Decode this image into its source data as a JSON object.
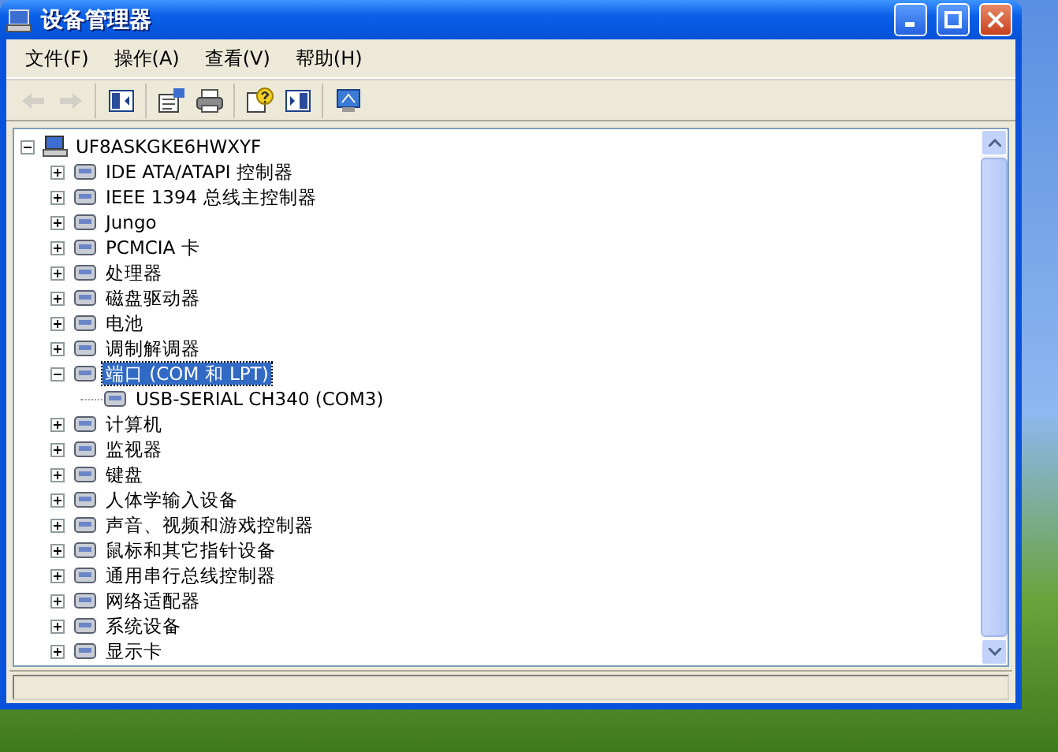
{
  "window": {
    "title": "设备管理器"
  },
  "menu": [
    {
      "label": "文件(F)"
    },
    {
      "label": "操作(A)"
    },
    {
      "label": "查看(V)"
    },
    {
      "label": "帮助(H)"
    }
  ],
  "toolbar": [
    [
      {
        "kind": "back",
        "disabled": true
      },
      {
        "kind": "forward",
        "disabled": true
      }
    ],
    [
      {
        "kind": "tree-toggle",
        "disabled": false
      }
    ],
    [
      {
        "kind": "properties",
        "disabled": false
      },
      {
        "kind": "print",
        "disabled": false
      }
    ],
    [
      {
        "kind": "help",
        "disabled": false
      },
      {
        "kind": "panel",
        "disabled": false
      }
    ],
    [
      {
        "kind": "scan",
        "disabled": false
      }
    ]
  ],
  "tree": [
    {
      "label": "UF8ASKGKE6HWXYF",
      "expanded": true,
      "selected": false,
      "children": [
        {
          "label": "IDE ATA/ATAPI 控制器",
          "expanded": false,
          "selected": false
        },
        {
          "label": "IEEE 1394 总线主控制器",
          "expanded": false,
          "selected": false
        },
        {
          "label": "Jungo",
          "expanded": false,
          "selected": false
        },
        {
          "label": "PCMCIA 卡",
          "expanded": false,
          "selected": false
        },
        {
          "label": "处理器",
          "expanded": false,
          "selected": false
        },
        {
          "label": "磁盘驱动器",
          "expanded": false,
          "selected": false
        },
        {
          "label": "电池",
          "expanded": false,
          "selected": false
        },
        {
          "label": "调制解调器",
          "expanded": false,
          "selected": false
        },
        {
          "label": "端口 (COM 和 LPT)",
          "expanded": true,
          "selected": true,
          "children": [
            {
              "label": "USB-SERIAL CH340 (COM3)",
              "selected": false
            }
          ]
        },
        {
          "label": "计算机",
          "expanded": false,
          "selected": false
        },
        {
          "label": "监视器",
          "expanded": false,
          "selected": false
        },
        {
          "label": "键盘",
          "expanded": false,
          "selected": false
        },
        {
          "label": "人体学输入设备",
          "expanded": false,
          "selected": false
        },
        {
          "label": "声音、视频和游戏控制器",
          "expanded": false,
          "selected": false
        },
        {
          "label": "鼠标和其它指针设备",
          "expanded": false,
          "selected": false
        },
        {
          "label": "通用串行总线控制器",
          "expanded": false,
          "selected": false
        },
        {
          "label": "网络适配器",
          "expanded": false,
          "selected": false
        },
        {
          "label": "系统设备",
          "expanded": false,
          "selected": false
        },
        {
          "label": "显示卡",
          "expanded": false,
          "selected": false
        }
      ]
    }
  ]
}
